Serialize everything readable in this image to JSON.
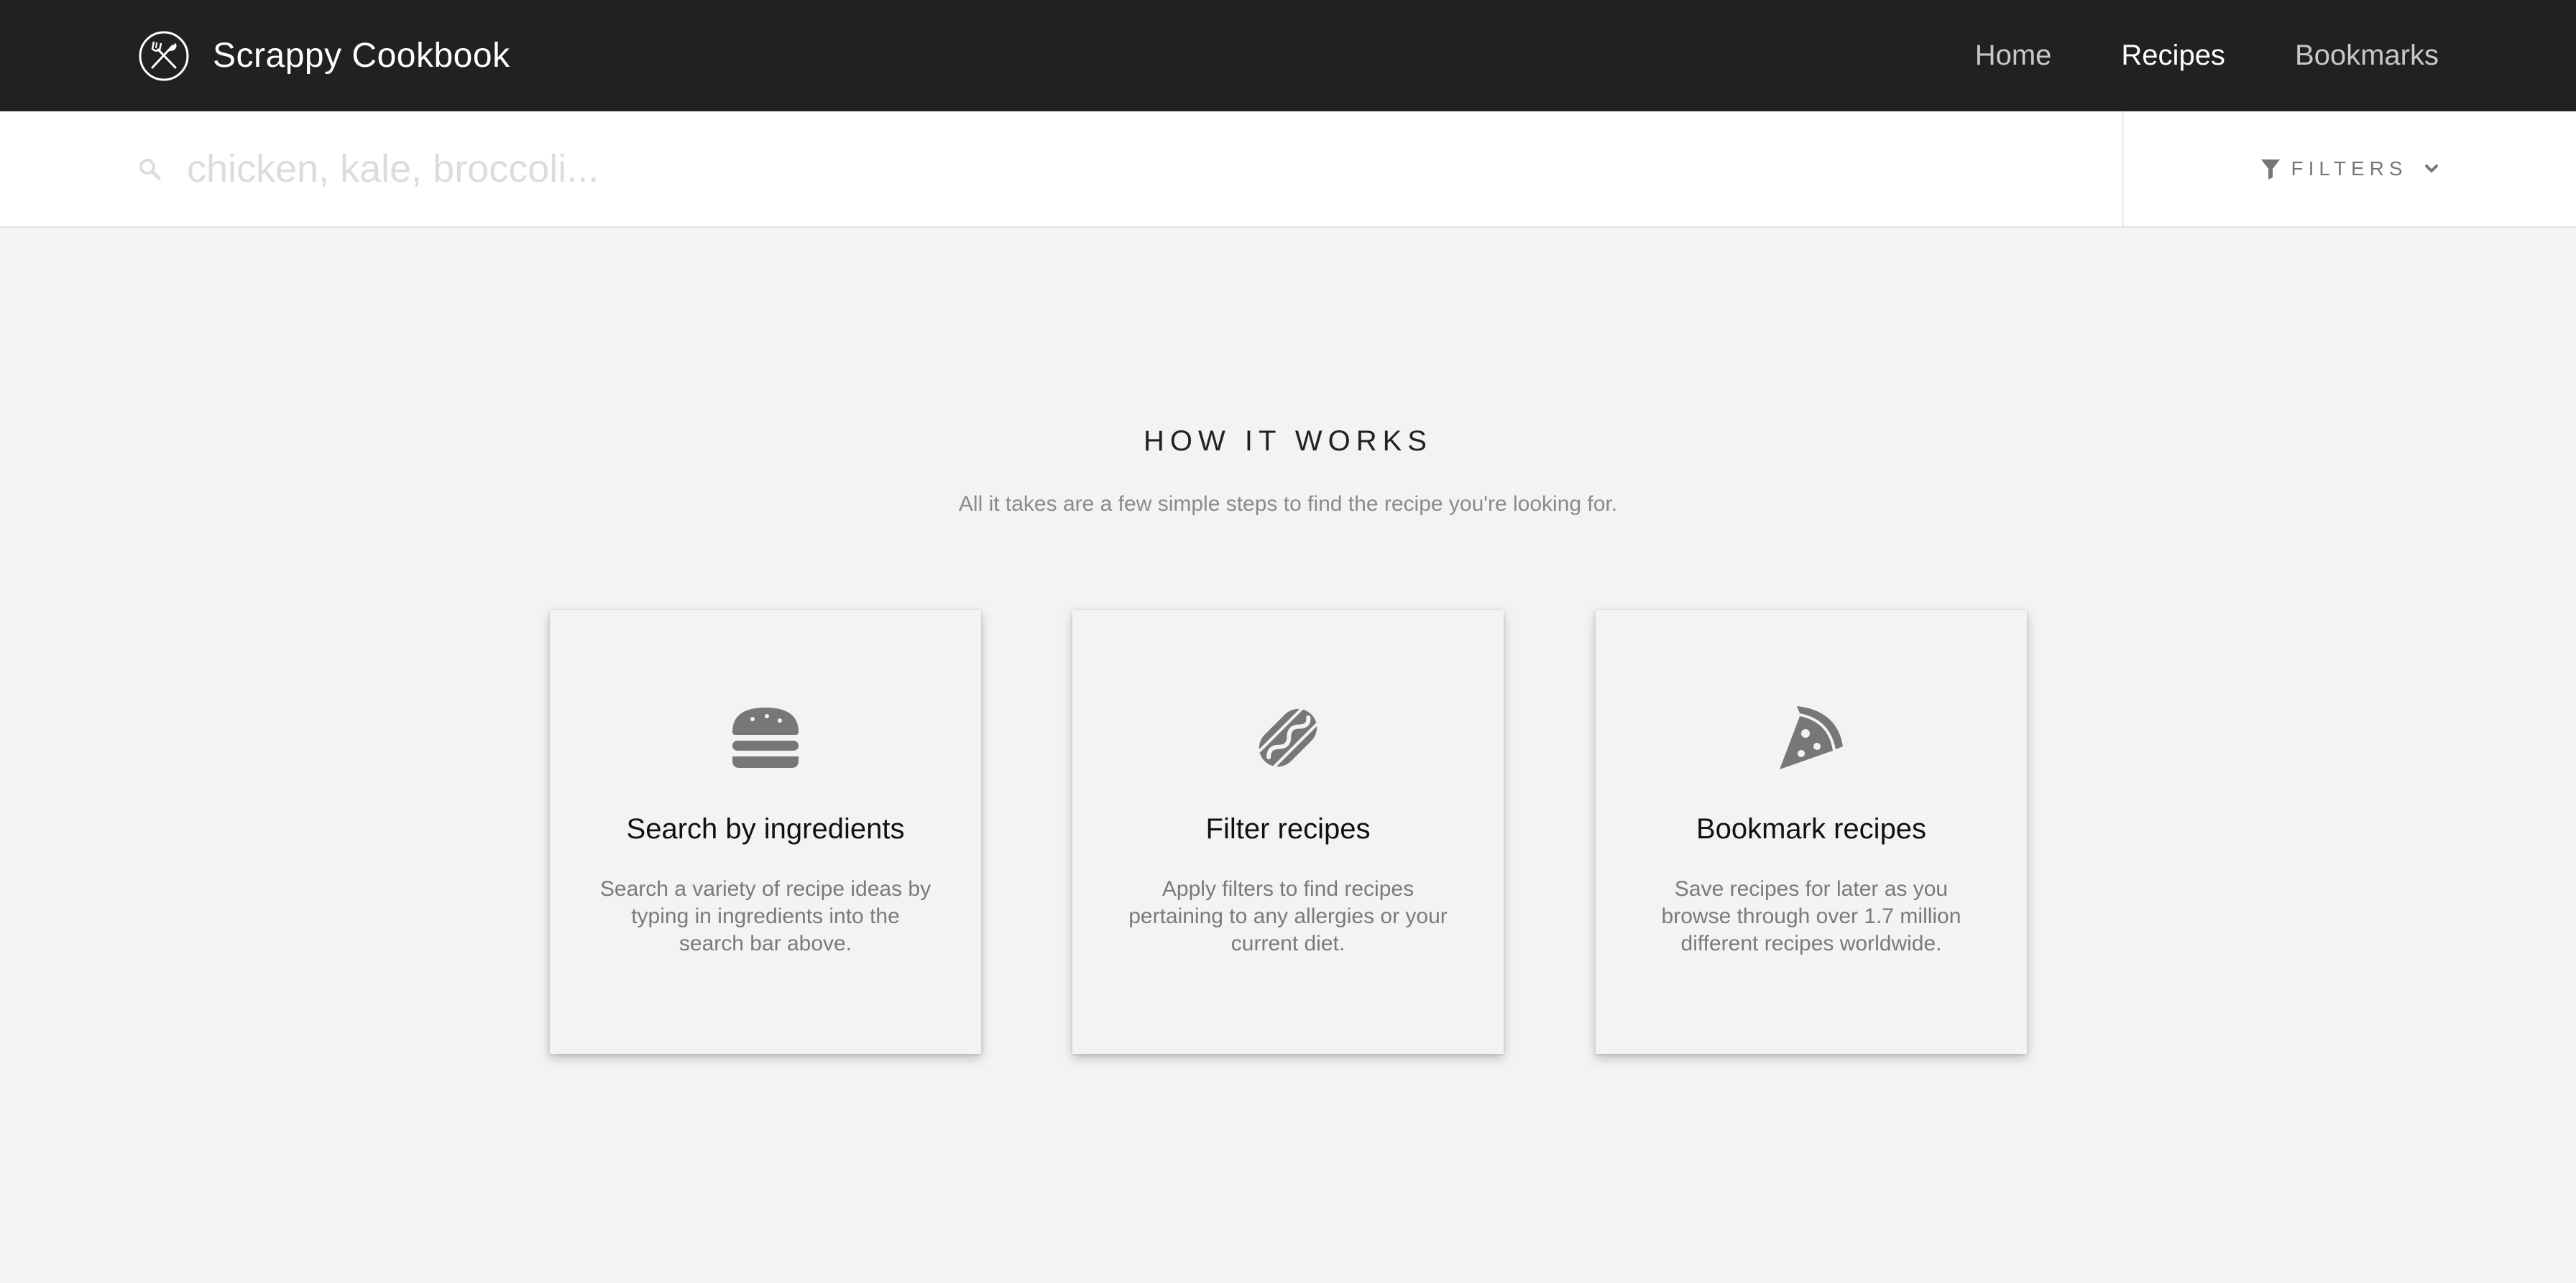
{
  "navbar": {
    "brand_name": "Scrappy Cookbook",
    "brand_icon": "fork-knife-logo-icon",
    "links": [
      {
        "label": "Home",
        "active": false
      },
      {
        "label": "Recipes",
        "active": true
      },
      {
        "label": "Bookmarks",
        "active": false
      }
    ]
  },
  "search": {
    "placeholder": "chicken, kale, broccoli...",
    "value": "",
    "icon": "search-icon",
    "filters_label": "FILTERS",
    "filters_icon": "filter-funnel-icon",
    "filters_chevron": "chevron-down-icon"
  },
  "how_it_works": {
    "title": "HOW IT WORKS",
    "subtitle": "All it takes are a few simple steps to find the recipe you're looking for.",
    "cards": [
      {
        "icon": "hamburger-icon",
        "title": "Search by ingredients",
        "text": "Search a variety of recipe ideas by typing in ingredients into the search bar above."
      },
      {
        "icon": "hotdog-icon",
        "title": "Filter recipes",
        "text": "Apply filters to find recipes pertaining to any allergies or your current diet."
      },
      {
        "icon": "pizza-slice-icon",
        "title": "Bookmark recipes",
        "text": "Save recipes for later as you browse through over 1.7 million different recipes worldwide."
      }
    ]
  },
  "colors": {
    "navbar_bg": "#212121",
    "page_bg": "#f3f3f3",
    "icon_gray": "#777777"
  }
}
